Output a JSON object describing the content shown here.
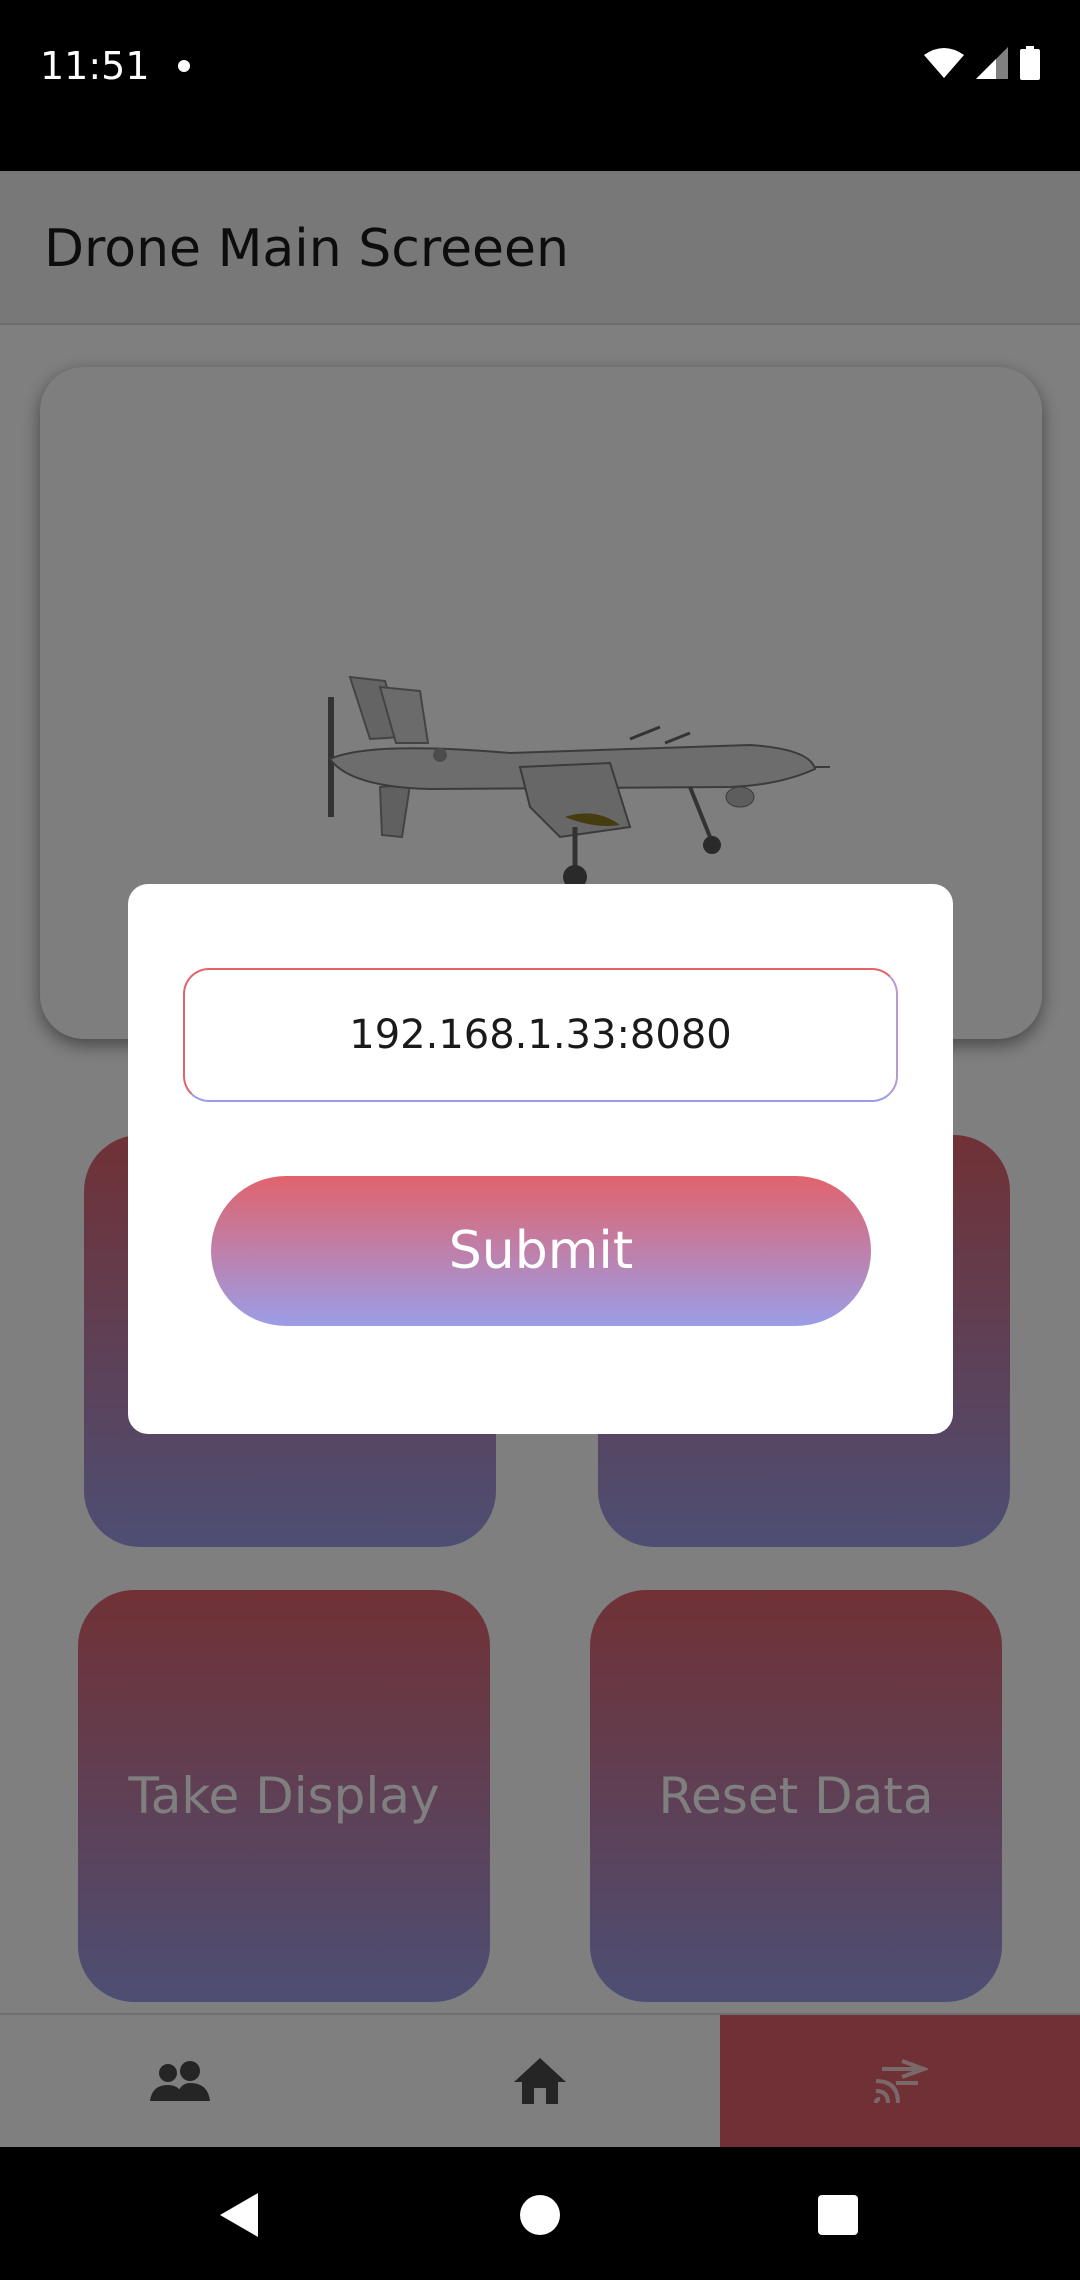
{
  "status_bar": {
    "time": "11:51"
  },
  "app_bar": {
    "title": "Drone Main Screeen"
  },
  "buttons": {
    "top_left": "",
    "top_right": "",
    "take_display": "Take Display",
    "reset_data": "Reset Data"
  },
  "dialog": {
    "input_value": "192.168.1.33:8080",
    "submit_label": "Submit"
  },
  "bottom_nav": {
    "items": [
      {
        "icon": "group-icon"
      },
      {
        "icon": "home-icon"
      },
      {
        "icon": "cast-connected-icon",
        "active": true
      }
    ]
  },
  "colors": {
    "gradient_top": "#e1636c",
    "gradient_bottom": "#9b9de8",
    "active_nav": "#e1636c"
  }
}
